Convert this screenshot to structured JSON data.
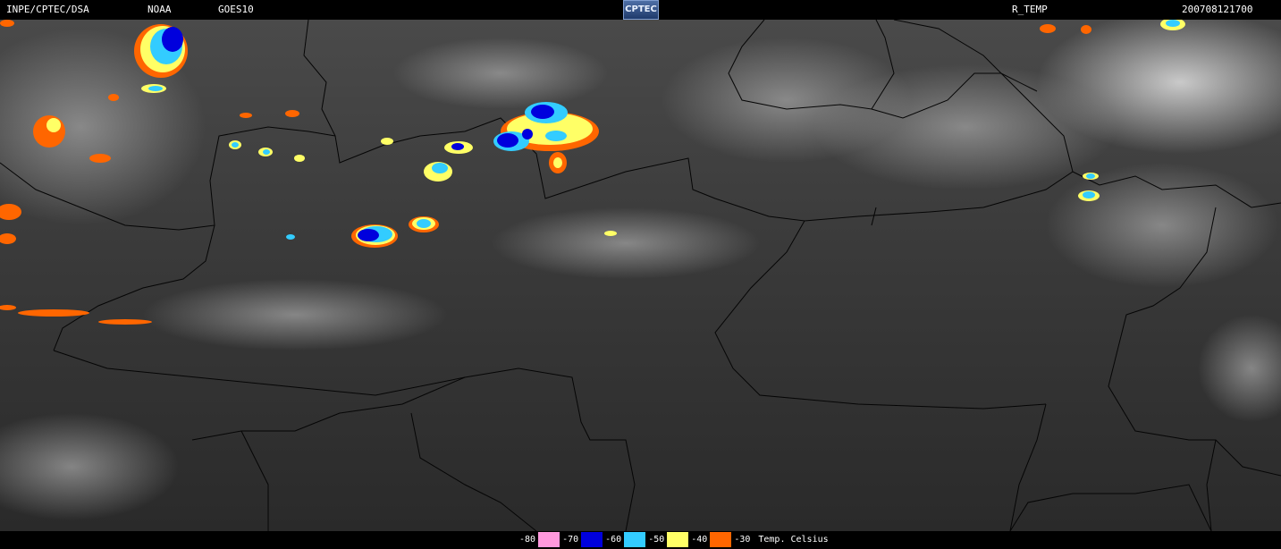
{
  "header": {
    "agency": "INPE/CPTEC/DSA",
    "source": "NOAA",
    "satellite": "GOES10",
    "logo_text": "CPTEC",
    "product": "R_TEMP",
    "timestamp": "200708121700"
  },
  "legend": {
    "units": "Temp. Celsius",
    "items": [
      {
        "label": "-80",
        "color": "#ff99dd"
      },
      {
        "label": "-70",
        "color": "#0000dd"
      },
      {
        "label": "-60",
        "color": "#33ccff"
      },
      {
        "label": "-50",
        "color": "#ffff66"
      },
      {
        "label": "-40",
        "color": "#ff6600"
      },
      {
        "label": "-30",
        "color": ""
      }
    ]
  },
  "colors": {
    "background": "#000000",
    "land_dark": "#2f2f2f",
    "cloud_light": "#cfcfcf",
    "border_line": "#000000"
  }
}
